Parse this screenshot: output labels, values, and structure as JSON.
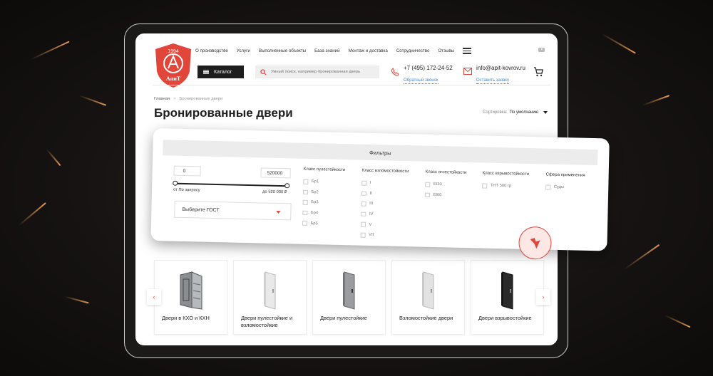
{
  "colors": {
    "accent": "#e2453a",
    "link": "#3d8bd8",
    "dark": "#1e1e1e"
  },
  "logo": {
    "year": "1994",
    "brand": "АпиТ"
  },
  "topnav": [
    "О производстве",
    "Услуги",
    "Выполненные объекты",
    "База знаний",
    "Монтаж и доставка",
    "Сотрудничество",
    "Отзывы"
  ],
  "header": {
    "catalog_label": "Каталог",
    "search_placeholder": "Умный поиск, например бронированная дверь",
    "phone": "+7 (495) 172-24-52",
    "phone_sub": "Обратный звонок",
    "email": "info@apit-kovrov.ru",
    "email_sub": "Оставить заявку"
  },
  "breadcrumb": {
    "home": "Главная",
    "sep": ">",
    "current": "Бронированные двери"
  },
  "page_title": "Бронированные двери",
  "sort": {
    "label": "Сортировка:",
    "value": "По умолчанию"
  },
  "filters": {
    "title": "Фильтры",
    "price_min": "0",
    "price_max": "520000",
    "price_from_label": "от По запросу",
    "price_to_label": "до 520 000 ₽",
    "gost_placeholder": "Выберите ГОСТ",
    "groups": [
      {
        "title": "Класс пулестойкости",
        "options": [
          "Бр1",
          "Бр2",
          "Бр3",
          "Бр4",
          "Бр5"
        ]
      },
      {
        "title": "Класс взломостойкости",
        "options": [
          "I",
          "II",
          "III",
          "IV",
          "V",
          "VII"
        ]
      },
      {
        "title": "Класс огнестойкости",
        "options": [
          "EI30",
          "EI60"
        ]
      },
      {
        "title": "Класс взрывостойкости",
        "options": [
          "ТНТ 500 гр"
        ]
      },
      {
        "title": "Сфера применения",
        "options": [
          "Суды"
        ]
      }
    ]
  },
  "products": [
    {
      "name": "Двери в КХО и КХН",
      "door": "steel-open-icon"
    },
    {
      "name": "Двери пулестойкие и взломостойкие",
      "door": "white-door-icon"
    },
    {
      "name": "Двери пулестойкие",
      "door": "grey-door-icon"
    },
    {
      "name": "Взломостойкие двери",
      "door": "white-door-icon"
    },
    {
      "name": "Двери взрывостойкие",
      "door": "black-door-icon"
    }
  ],
  "carousel": {
    "prev": "‹",
    "next": "›"
  }
}
